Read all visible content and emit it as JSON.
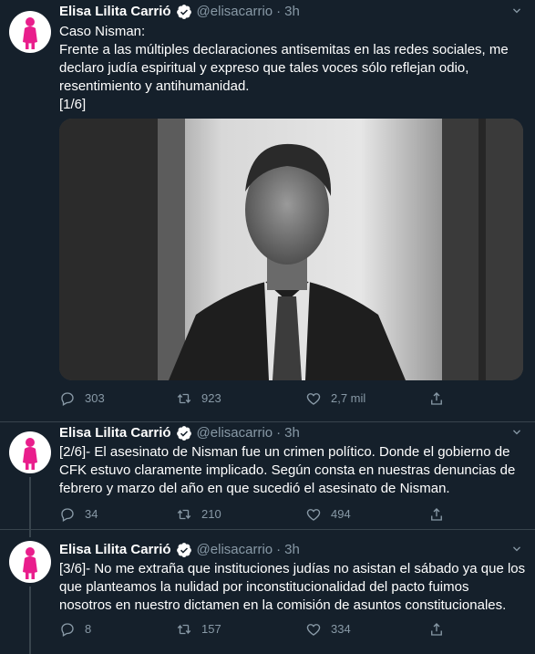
{
  "colors": {
    "background": "#15202b",
    "secondary_text": "#8899a6",
    "verified_blue": "#1da1f2",
    "divider": "#38444d",
    "avatar_figure": "#e91e8c"
  },
  "author": {
    "name": "Elisa Lilita Carrió",
    "handle": "@elisacarrio",
    "separator": "·"
  },
  "tweets": [
    {
      "time": "3h",
      "lines": [
        "Caso Nisman:",
        "Frente a las múltiples declaraciones antisemitas en las redes sociales, me",
        "declaro judía espiritual y expreso que tales voces sólo reflejan odio,",
        "resentimiento y antihumanidad.",
        "[1/6]"
      ],
      "media": {
        "alt_icon": "portrait-photo"
      },
      "replies": "303",
      "retweets": "923",
      "likes": "2,7 mil"
    },
    {
      "time": "3h",
      "lines": [
        "[2/6]- El asesinato de Nisman fue un crimen político. Donde el gobierno de",
        "CFK estuvo claramente implicado. Según consta en nuestras denuncias de",
        "febrero y marzo del año en que sucedió el asesinato de Nisman."
      ],
      "replies": "34",
      "retweets": "210",
      "likes": "494"
    },
    {
      "time": "3h",
      "lines": [
        "[3/6]- No me extraña que instituciones judías no asistan el sábado ya que los",
        "que planteamos la nulidad por inconstitucionalidad del pacto fuimos",
        "nosotros en nuestro dictamen en la comisión de asuntos constitucionales."
      ],
      "replies": "8",
      "retweets": "157",
      "likes": "334"
    }
  ]
}
